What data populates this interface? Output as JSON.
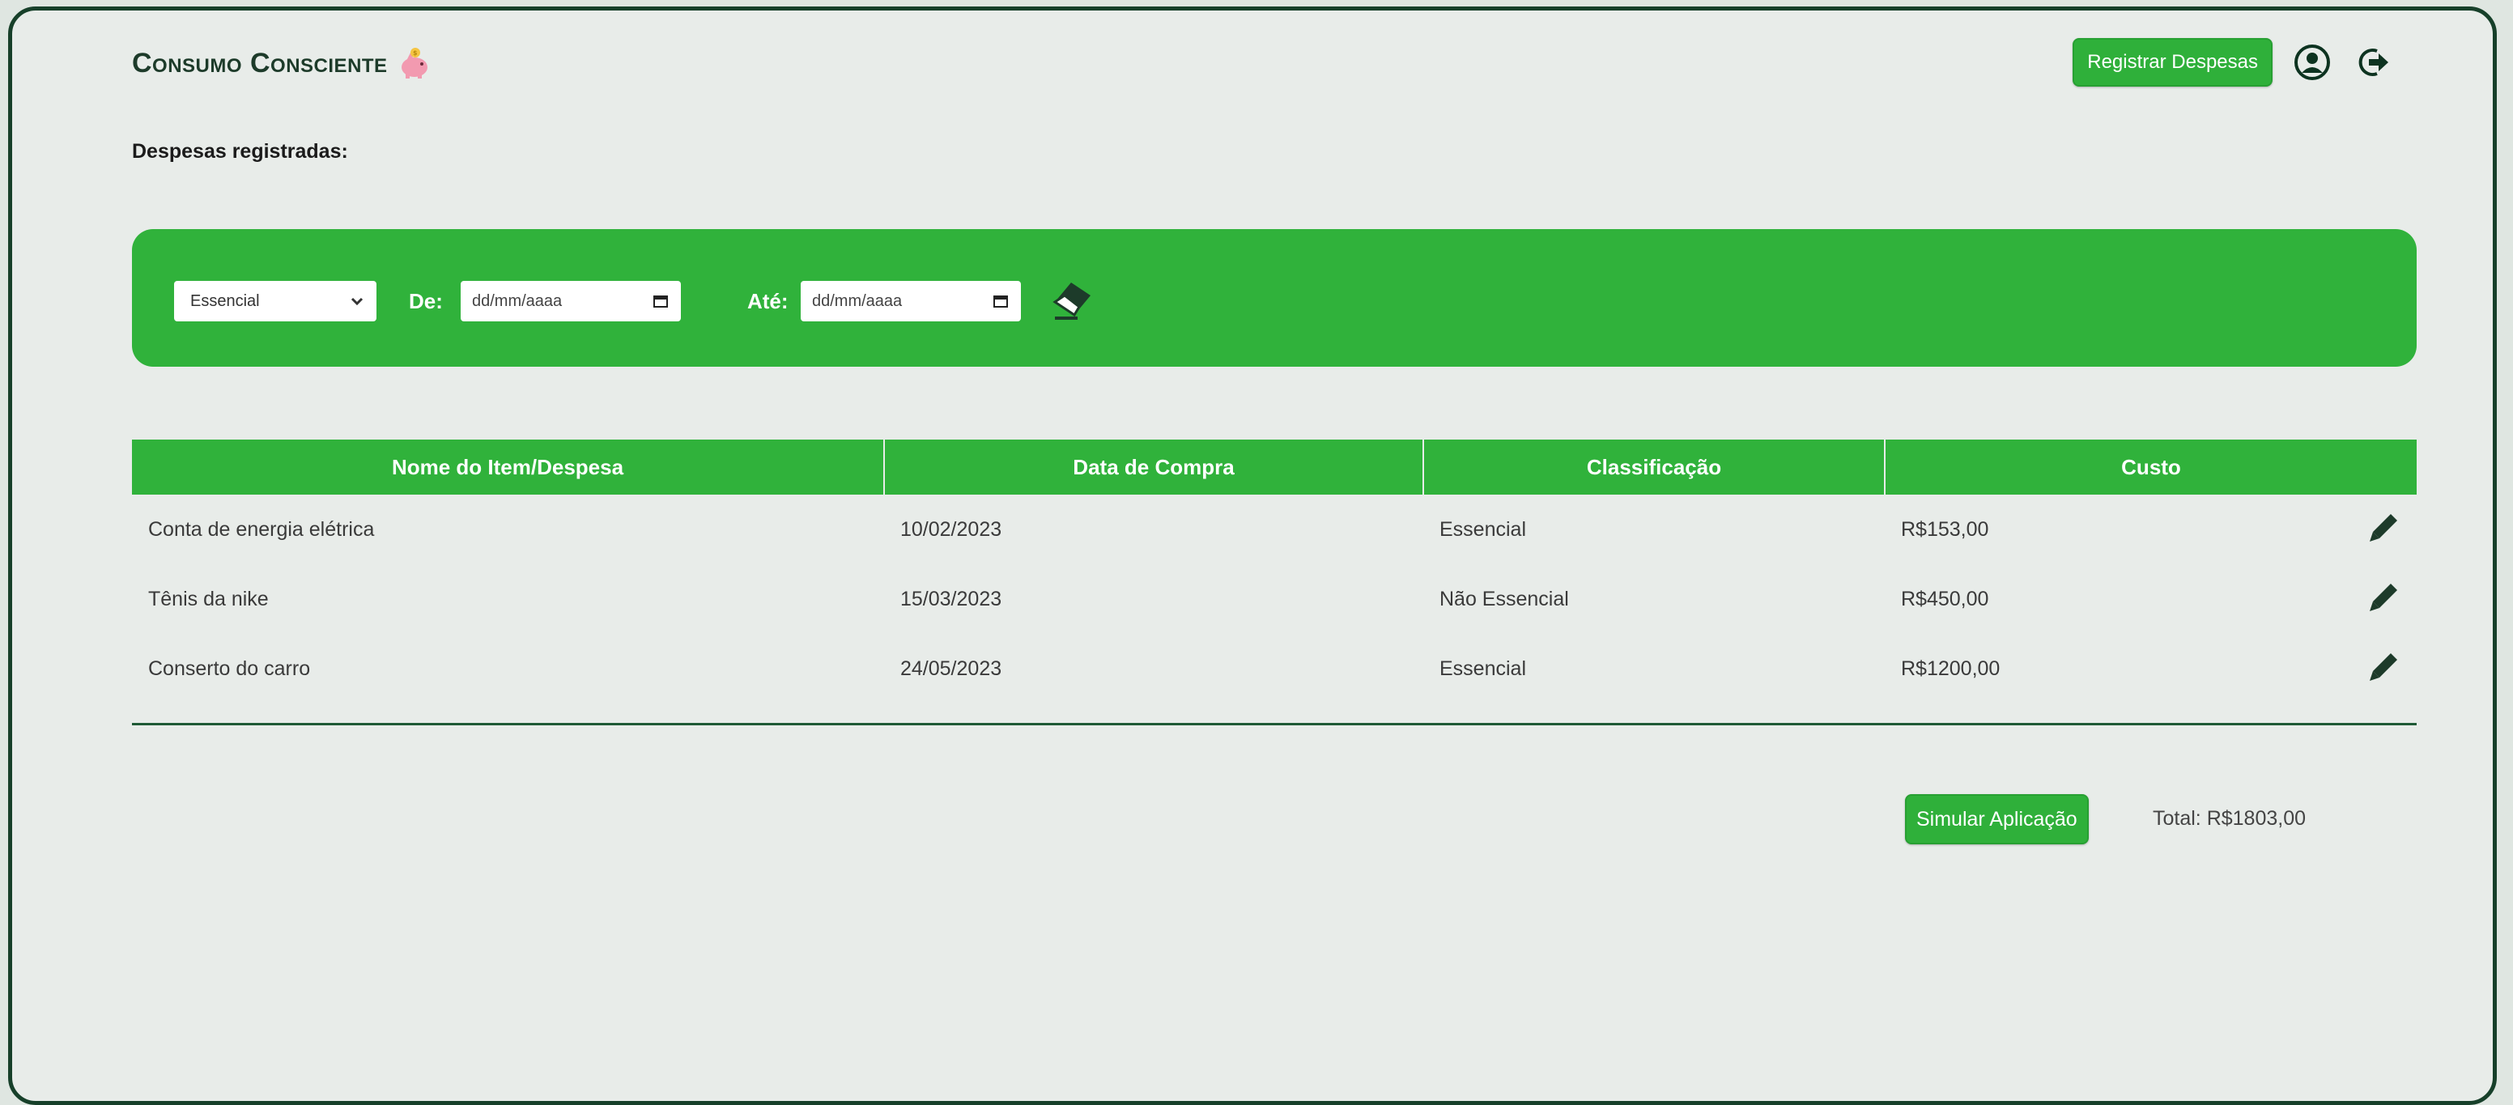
{
  "app": {
    "title": "Consumo Consciente"
  },
  "header": {
    "register_button": "Registrar Despesas",
    "icons": [
      "user-circle-icon",
      "logout-icon"
    ]
  },
  "section_title": "Despesas registradas:",
  "filters": {
    "category_value": "Essencial",
    "from_label": "De:",
    "from_placeholder": "dd/mm/aaaa",
    "to_label": "Até:",
    "to_placeholder": "dd/mm/aaaa",
    "clear_icon": "eraser-icon"
  },
  "table": {
    "columns": [
      "Nome do Item/Despesa",
      "Data de Compra",
      "Classificação",
      "Custo"
    ],
    "rows": [
      {
        "name": "Conta de energia elétrica",
        "date": "10/02/2023",
        "class": "Essencial",
        "cost": "R$153,00"
      },
      {
        "name": "Tênis da nike",
        "date": "15/03/2023",
        "class": "Não Essencial",
        "cost": "R$450,00"
      },
      {
        "name": "Conserto do carro",
        "date": "24/05/2023",
        "class": "Essencial",
        "cost": "R$1200,00"
      }
    ]
  },
  "footer": {
    "simulate_button": "Simular Aplicação",
    "total": "Total: R$1803,00"
  },
  "colors": {
    "brand_green": "#30b23b",
    "dark_green": "#17402a",
    "background": "#e8ece9"
  }
}
